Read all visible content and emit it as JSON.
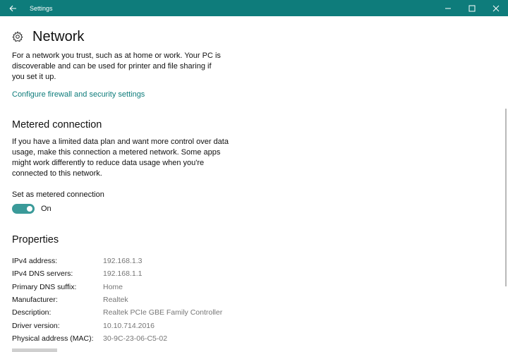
{
  "window": {
    "title": "Settings",
    "accent": "#0e7c7b"
  },
  "page": {
    "title": "Network",
    "icon": "gear-icon",
    "description": "For a network you trust, such as at home or work. Your PC is discoverable and can be used for printer and file sharing if you set it up.",
    "firewall_link": "Configure firewall and security settings"
  },
  "metered": {
    "heading": "Metered connection",
    "description": "If you have a limited data plan and want more control over data usage, make this connection a metered network. Some apps might work differently to reduce data usage when you're connected to this network.",
    "toggle_label": "Set as metered connection",
    "toggle_state": "On"
  },
  "properties": {
    "heading": "Properties",
    "rows": [
      {
        "key": "IPv4 address:",
        "value": "192.168.1.3"
      },
      {
        "key": "IPv4 DNS servers:",
        "value": "192.168.1.1"
      },
      {
        "key": "Primary DNS suffix:",
        "value": "Home"
      },
      {
        "key": "Manufacturer:",
        "value": "Realtek"
      },
      {
        "key": "Description:",
        "value": "Realtek PCIe GBE Family Controller"
      },
      {
        "key": "Driver version:",
        "value": "10.10.714.2016"
      },
      {
        "key": "Physical address (MAC):",
        "value": "30-9C-23-06-C5-02"
      }
    ]
  }
}
